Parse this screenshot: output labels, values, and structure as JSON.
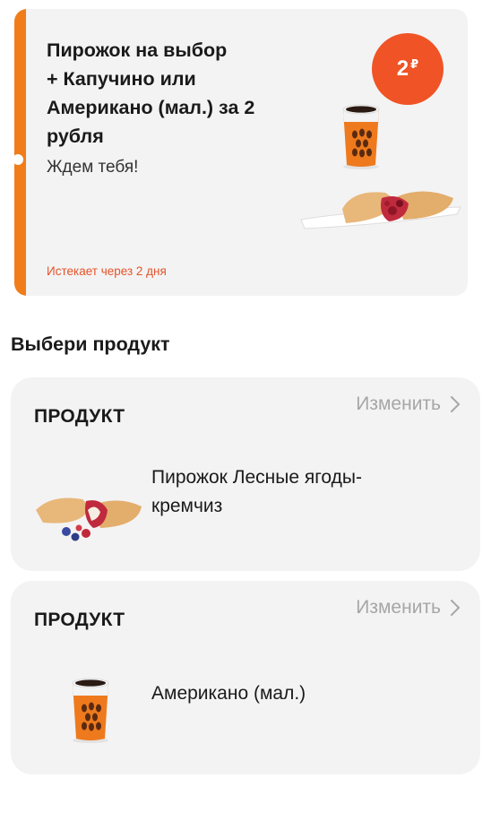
{
  "coupon": {
    "title": "Пирожок на выбор\n+ Капучино или\nАмерикано (мал.) за 2\nрубля",
    "subtitle": "Ждем тебя!",
    "expiry": "Истекает через 2 дня",
    "price_value": "2",
    "price_currency": "₽",
    "accent_color": "#f07d1a",
    "badge_color": "#f05325",
    "images": [
      "coffee-cup-image",
      "pie-image"
    ]
  },
  "section": {
    "title": "Выбери продукт"
  },
  "products": [
    {
      "label": "ПРОДУКТ",
      "change_label": "Изменить",
      "name": "Пирожок Лесные ягоды-кремчиз",
      "image": "berry-pie-image"
    },
    {
      "label": "ПРОДУКТ",
      "change_label": "Изменить",
      "name": "Американо (мал.)",
      "image": "coffee-cup-image"
    }
  ]
}
